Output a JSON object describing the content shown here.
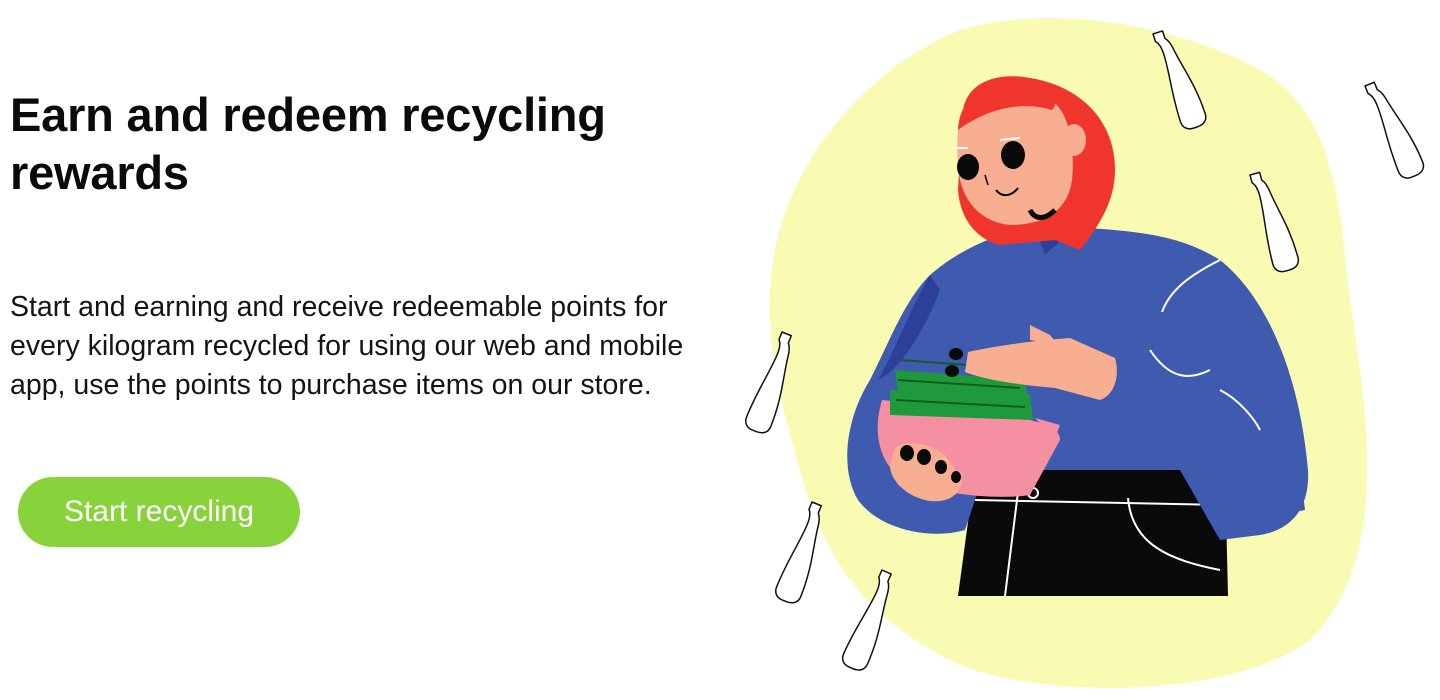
{
  "hero": {
    "title": "Earn and redeem recycling rewards",
    "description": "Start and earning and receive redeemable points for every kilogram recycled for using our web and mobile app, use the points to purchase items on our store.",
    "cta_label": "Start recycling"
  },
  "colors": {
    "blob": "#fafbb2",
    "cta": "#88d33c",
    "hair": "#f0352d",
    "skin": "#f8ae90",
    "sweater": "#3f5bb0",
    "pants": "#0a0a0a",
    "bucket": "#f58fa2",
    "cash": "#1e9a3c"
  },
  "illustration": {
    "icons": [
      "bottle-icon",
      "woman-holding-money-illustration"
    ]
  }
}
